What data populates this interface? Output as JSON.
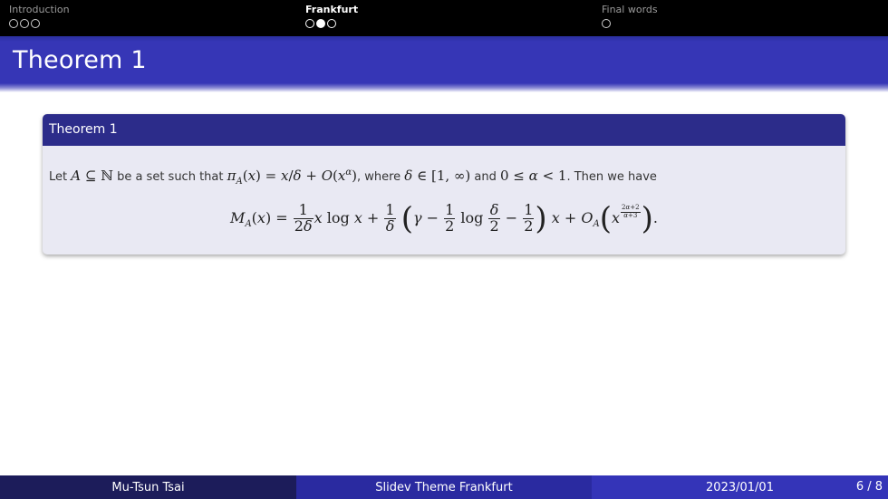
{
  "nav": {
    "sections": [
      {
        "title": "Introduction",
        "dots": [
          false,
          false,
          false
        ],
        "active": false
      },
      {
        "title": "Frankfurt",
        "dots": [
          false,
          true,
          false
        ],
        "active": true
      },
      {
        "title": "Final words",
        "dots": [
          false
        ],
        "active": false
      }
    ]
  },
  "slide": {
    "title": "Theorem 1"
  },
  "theorem": {
    "title": "Theorem 1",
    "text": {
      "let": "Let",
      "be_set": "be a set such that",
      "where": ", where",
      "and": "and",
      "then": ". Then we have"
    }
  },
  "footer": {
    "author": "Mu-Tsun Tsai",
    "title": "Slidev Theme Frankfurt",
    "date": "2023/01/01",
    "page": "6 / 8"
  },
  "colors": {
    "nav_bg": "#000000",
    "title_bar": "#3636b6",
    "theorem_header": "#2c2c8a",
    "theorem_body": "#e9e9f3",
    "footer_1": "#1c1c5a",
    "footer_2": "#2a2aa0",
    "footer_3": "#3434b8"
  }
}
